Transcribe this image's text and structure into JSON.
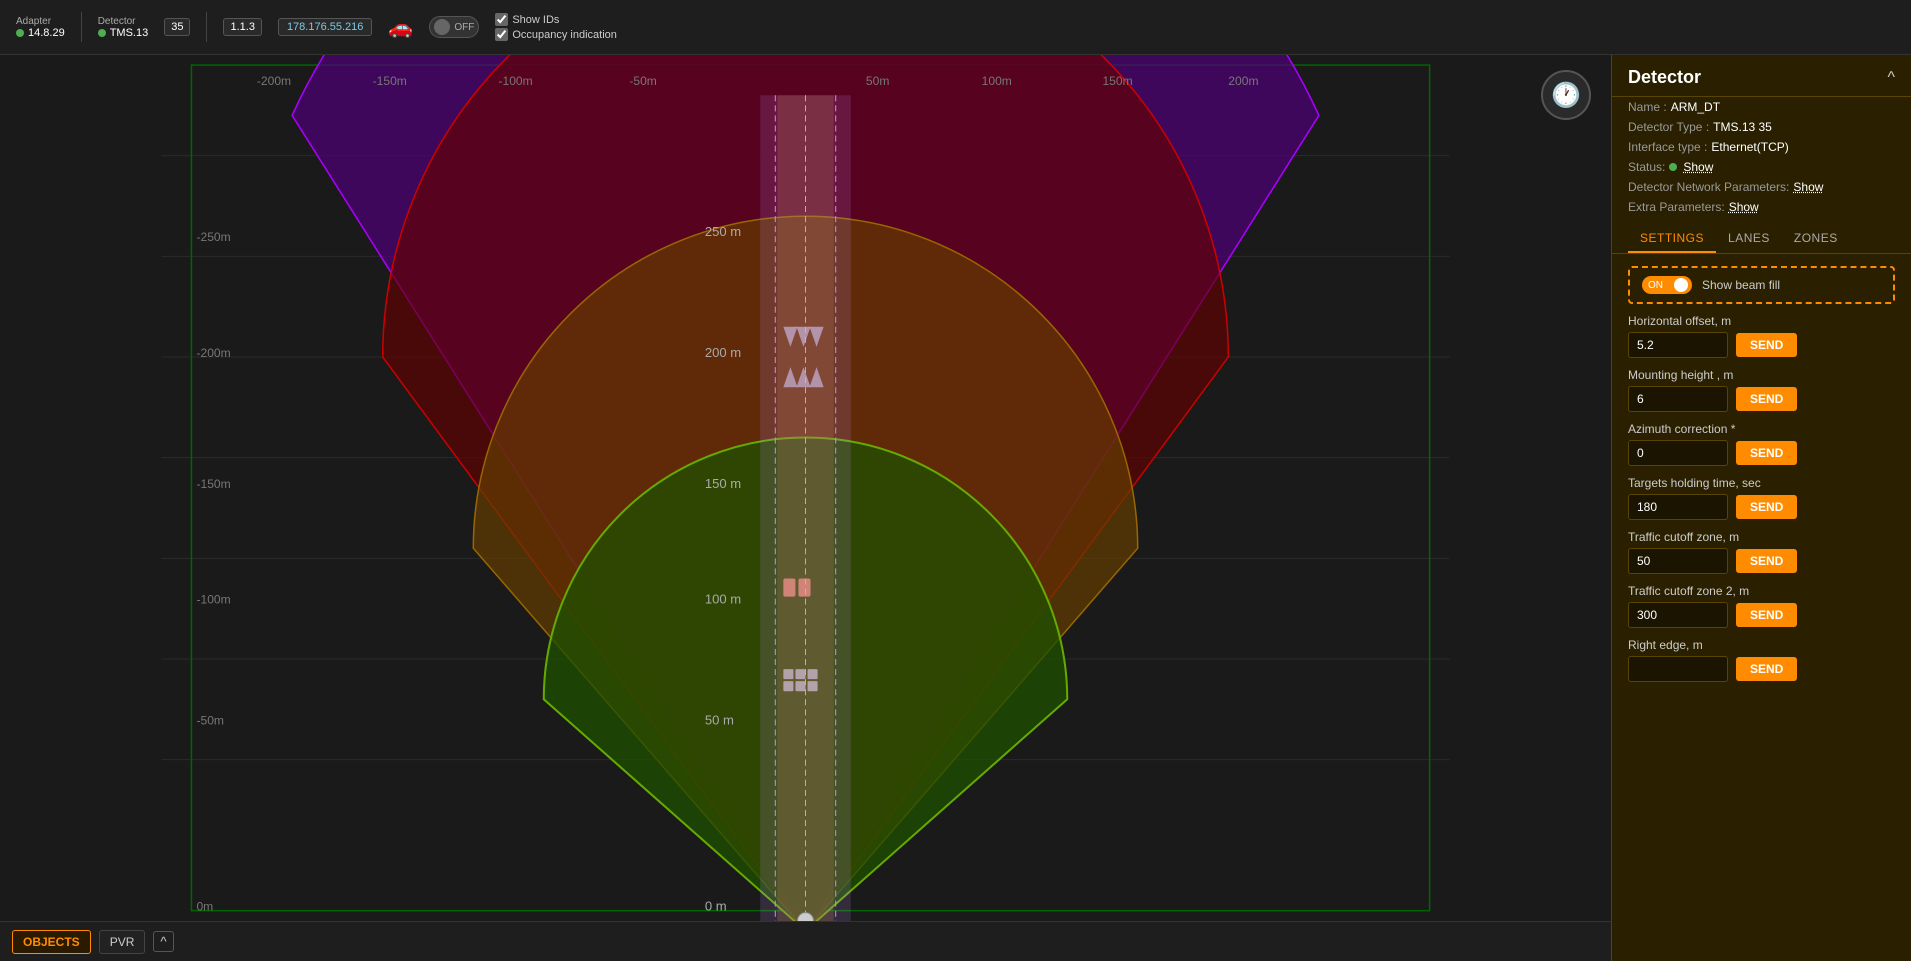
{
  "topbar": {
    "adapter_label": "Adapter",
    "adapter_value": "14.8.29",
    "detector_label": "Detector",
    "detector_value": "TMS.13",
    "detector_id": "35",
    "version": "1.1.3",
    "ip": "178.176.55.216",
    "toggle_state": "OFF",
    "checkbox_show_ids": "Show IDs",
    "checkbox_occupancy": "Occupancy indication"
  },
  "canvas": {
    "x_labels": [
      "-200m",
      "-150m",
      "-100m",
      "-50m",
      "50m",
      "100m",
      "150m",
      "200m"
    ],
    "y_labels": [
      "-250m",
      "-200m",
      "-150m",
      "-100m",
      "-50m",
      "0m"
    ],
    "dist_labels": [
      "250 m",
      "200 m",
      "150 m",
      "100 m",
      "50 m",
      "0 m"
    ],
    "bottom_buttons": [
      "OBJECTS",
      "PVR"
    ],
    "expand_label": "^"
  },
  "right_panel": {
    "title": "Detector",
    "collapse_icon": "^",
    "name_label": "Name :",
    "name_value": "ARM_DT",
    "type_label": "Detector Type :",
    "type_value": "TMS.13 35",
    "interface_label": "Interface type :",
    "interface_value": "Ethernet(TCP)",
    "status_label": "Status:",
    "status_link": "Show",
    "network_label": "Detector Network Parameters:",
    "network_link": "Show",
    "extra_label": "Extra Parameters:",
    "extra_link": "Show",
    "tabs": [
      "SETTINGS",
      "LANES",
      "ZONES"
    ],
    "active_tab": "SETTINGS",
    "beam_fill_label": "Show beam fill",
    "beam_fill_state": "ON",
    "fields": [
      {
        "label": "Horizontal offset, m",
        "value": "5.2",
        "key": "horizontal_offset"
      },
      {
        "label": "Mounting height , m",
        "value": "6",
        "key": "mounting_height"
      },
      {
        "label": "Azimuth correction *",
        "value": "0",
        "key": "azimuth_correction"
      },
      {
        "label": "Targets holding time, sec",
        "value": "180",
        "key": "targets_holding"
      },
      {
        "label": "Traffic cutoff zone, m",
        "value": "50",
        "key": "traffic_cutoff"
      },
      {
        "label": "Traffic cutoff zone 2, m",
        "value": "300",
        "key": "traffic_cutoff2"
      },
      {
        "label": "Right edge, m",
        "value": "",
        "key": "right_edge"
      }
    ],
    "send_label": "SEND"
  }
}
